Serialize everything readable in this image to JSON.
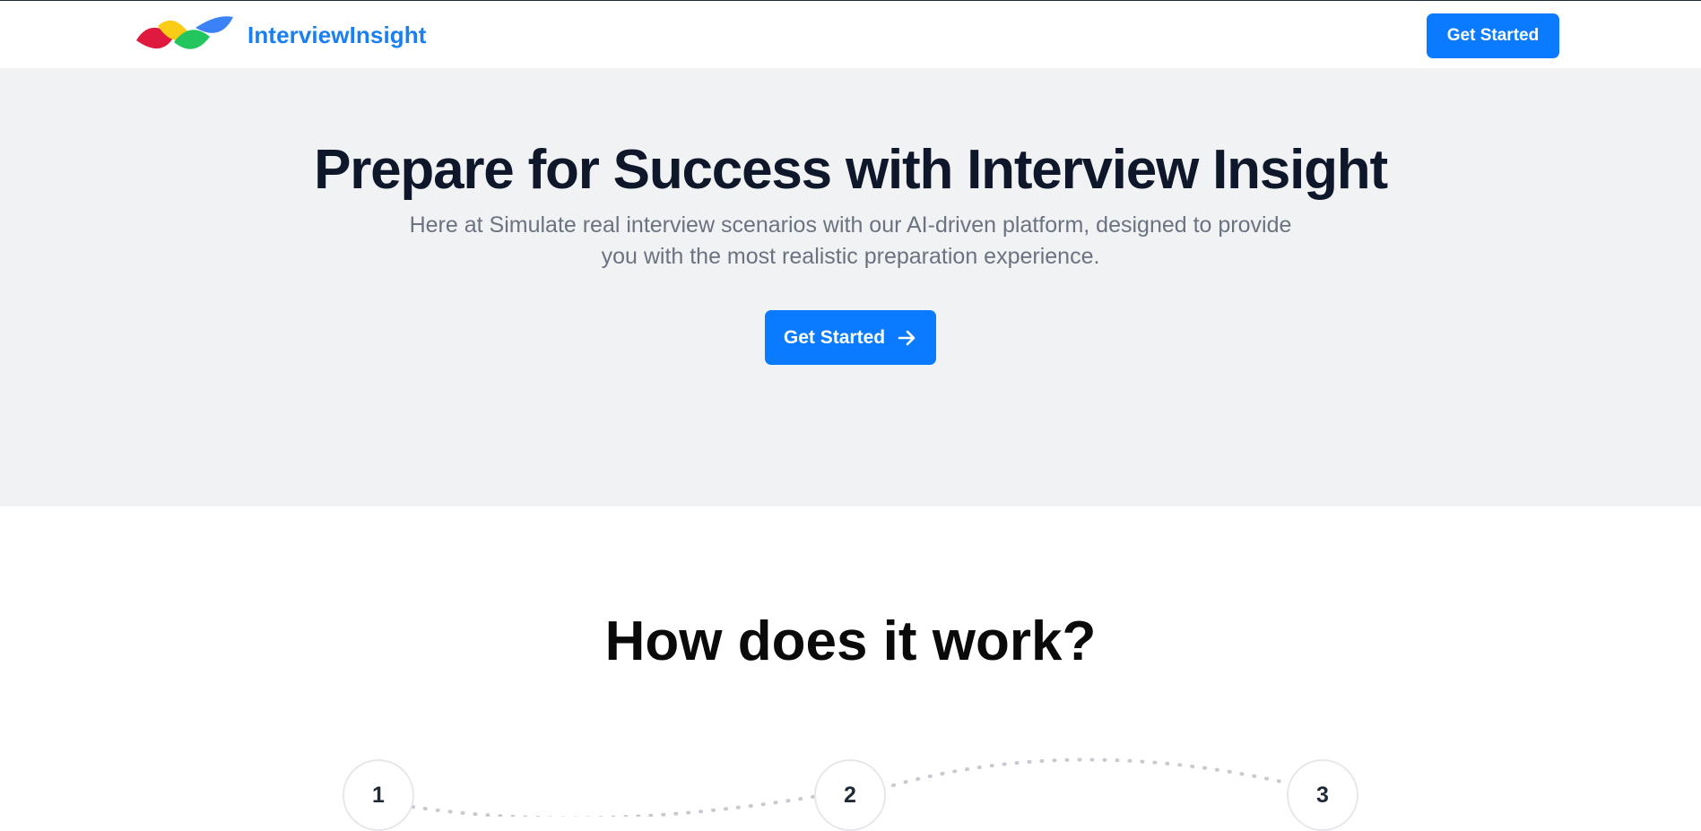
{
  "header": {
    "brand_name": "InterviewInsight",
    "cta_label": "Get Started"
  },
  "hero": {
    "title": "Prepare for Success with Interview Insight",
    "subtitle": "Here at Simulate real interview scenarios with our AI-driven platform, designed to provide you with the most realistic preparation experience.",
    "cta_label": "Get Started",
    "cta_icon": "arrow-right-icon"
  },
  "how_it_works": {
    "title": "How does it work?",
    "steps": [
      "1",
      "2",
      "3"
    ]
  },
  "colors": {
    "accent": "#0a7bff",
    "brand_text": "#1a7ff2",
    "hero_bg": "#f1f2f4",
    "logo": [
      "#e11d48",
      "#facc15",
      "#22c55e",
      "#3b82f6"
    ]
  }
}
